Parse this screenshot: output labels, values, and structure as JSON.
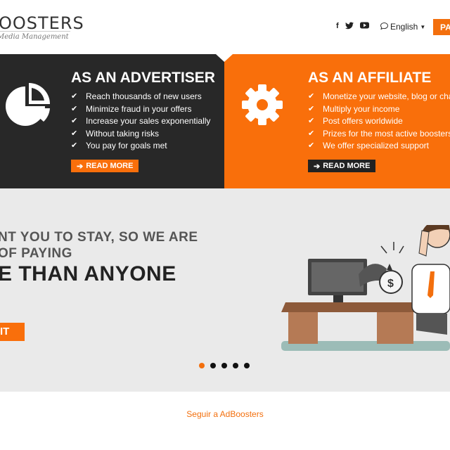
{
  "header": {
    "logo_main": "OOSTERS",
    "logo_sub": "Media Management",
    "social_icons": [
      "facebook-icon",
      "twitter-icon",
      "youtube-icon"
    ],
    "language_label": "English",
    "cta_partial": "PA"
  },
  "advertiser": {
    "title": "AS AN ADVERTISER",
    "icon": "pie-chart-icon",
    "items": [
      "Reach thousands of new users",
      "Minimize fraud in your offers",
      "Increase your sales exponentially",
      "Without taking risks",
      "You pay for goals met"
    ],
    "button_label": "READ MORE"
  },
  "affiliate": {
    "title": "AS AN AFFILIATE",
    "icon": "gear-icon",
    "items": [
      "Monetize your website, blog or cha",
      "Multiply your income",
      "Post offers worldwide",
      "Prizes for the most active boosters",
      "We offer specialized support"
    ],
    "button_label": "READ MORE"
  },
  "hero": {
    "line1": "NT YOU TO STAY, SO WE ARE",
    "line2": " OF PAYING",
    "line3": "E THAN ANYONE",
    "button_label": "IT",
    "slides_count": 5,
    "active_slide": 1
  },
  "footer": {
    "follow_link": "Seguir a AdBoosters"
  },
  "colors": {
    "accent": "#f96f0b",
    "dark_panel": "#282828",
    "hero_bg": "#eaeaea"
  }
}
